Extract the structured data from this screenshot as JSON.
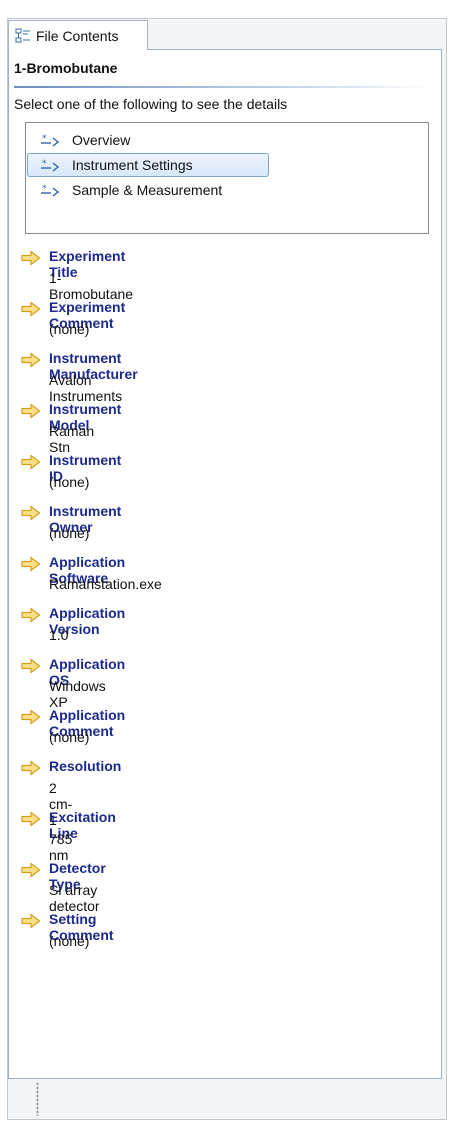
{
  "tab": {
    "label": "File Contents",
    "icon": "file-contents-icon"
  },
  "heading": "1-Bromobutane",
  "instruction": "Select one of the following to see the details",
  "sections": [
    {
      "label": "Overview",
      "icon": "section-arrow-icon",
      "selected": false
    },
    {
      "label": "Instrument Settings",
      "icon": "section-arrow-icon",
      "selected": true
    },
    {
      "label": "Sample & Measurement",
      "icon": "section-arrow-icon",
      "selected": false
    }
  ],
  "properties": [
    {
      "title": "Experiment Title",
      "value": "1-Bromobutane"
    },
    {
      "title": "Experiment Comment",
      "value": "(none)"
    },
    {
      "title": "Instrument Manufacturer",
      "value": "Avalon Instruments"
    },
    {
      "title": "Instrument Model",
      "value": "Raman Stn"
    },
    {
      "title": "Instrument ID",
      "value": "(none)"
    },
    {
      "title": "Instrument Owner",
      "value": "(none)"
    },
    {
      "title": "Application Software",
      "value": "Ramanstation.exe"
    },
    {
      "title": "Application Version",
      "value": "1.0"
    },
    {
      "title": "Application OS",
      "value": "Windows XP"
    },
    {
      "title": "Application Comment",
      "value": "(none)"
    },
    {
      "title": "Resolution",
      "value": "2 cm-1"
    },
    {
      "title": "Excitation Line",
      "value": "785 nm"
    },
    {
      "title": "Detector Type",
      "value": "Si array detector"
    },
    {
      "title": "Setting Comment",
      "value": "(none)"
    }
  ],
  "colors": {
    "property_title": "#1b2a8c",
    "arrow_fill": "#f8e08a",
    "arrow_stroke": "#d4a01a",
    "selection_border": "#7da2ce"
  }
}
